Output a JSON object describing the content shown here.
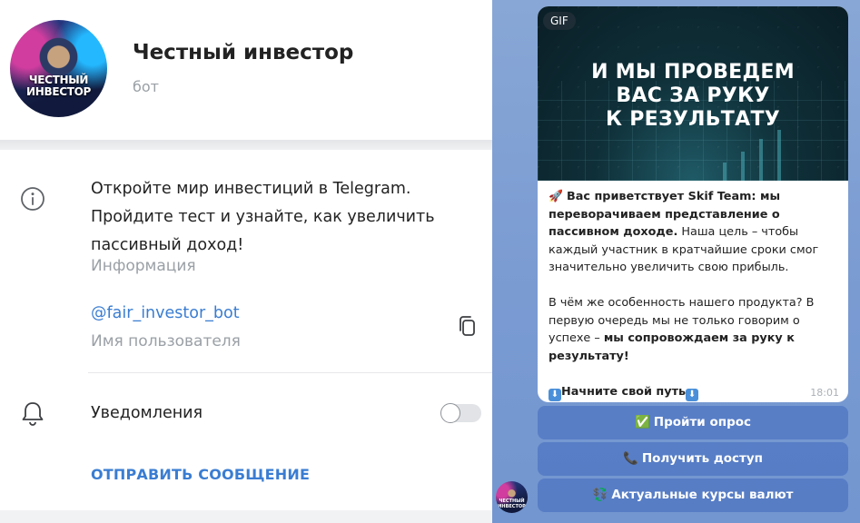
{
  "profile": {
    "name": "Честный инвестор",
    "type": "бот",
    "avatar_text_line1": "ЧЕСТНЫЙ",
    "avatar_text_line2": "ИНВЕСТОР",
    "info": {
      "description": "Откройте мир инвестиций в Telegram. Пройдите тест и узнайте, как увеличить пассивный доход!",
      "label": "Информация"
    },
    "username": {
      "value": "@fair_investor_bot",
      "label": "Имя пользователя"
    },
    "notifications": {
      "label": "Уведомления",
      "enabled": false
    },
    "send_message_label": "ОТПРАВИТЬ СООБЩЕНИЕ",
    "icons": [
      "info-icon",
      "copy-icon",
      "bell-icon"
    ]
  },
  "chat": {
    "message": {
      "gif_badge": "GIF",
      "gif_title_line1": "И МЫ ПРОВЕДЕМ",
      "gif_title_line2": "ВАС ЗА РУКУ",
      "gif_title_line3": "К РЕЗУЛЬТАТУ",
      "p1_emoji": "🚀",
      "p1_bold": "Вас приветствует Skif Team: мы переворачиваем представление о пассивном доходе.",
      "p1_rest": " Наша цель – чтобы каждый участник в кратчайшие сроки смог значительно увеличить свою прибыль.",
      "p2_plain": "В чём же особенность нашего продукта? В первую очередь мы не только говорим о успехе – ",
      "p2_bold": "мы сопровождаем за руку к результату!",
      "p3_emoji_left": "⬇",
      "p3_bold": "Начните свой путь",
      "p3_emoji_right": "⬇",
      "time": "18:01"
    },
    "buttons": [
      {
        "icon": "✅",
        "label": "Пройти опрос"
      },
      {
        "icon": "📞",
        "label": "Получить доступ"
      },
      {
        "icon": "💱",
        "label": "Актуальные курсы валют"
      }
    ],
    "colors": {
      "background": "#7a9bd2",
      "link": "#3a7dd2",
      "button": "#5a7fc8"
    }
  }
}
